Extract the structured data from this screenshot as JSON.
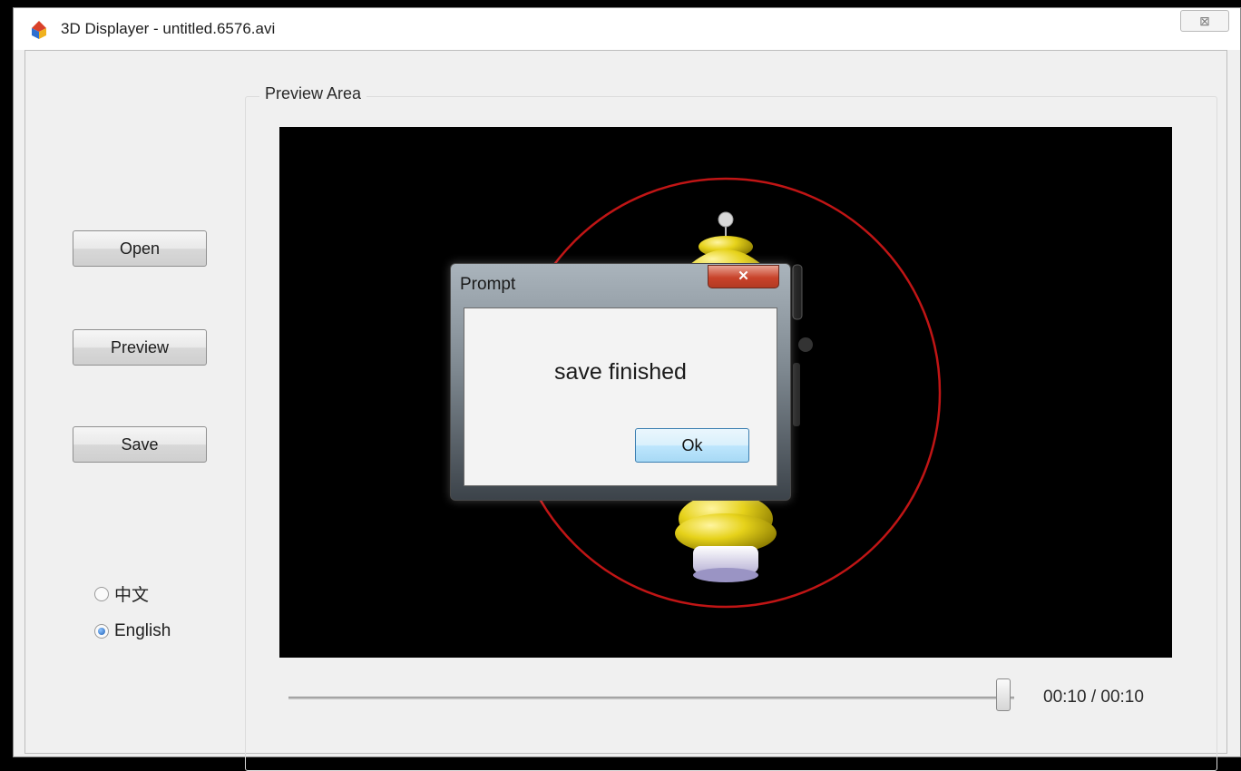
{
  "window": {
    "title": "3D Displayer - untitled.6576.avi",
    "close_symbol": "⊠",
    "app_icon": "app-logo-icon"
  },
  "sidebar": {
    "open_label": "Open",
    "preview_label": "Preview",
    "save_label": "Save"
  },
  "language": {
    "options": [
      {
        "label": "中文",
        "checked": false
      },
      {
        "label": "English",
        "checked": true
      }
    ]
  },
  "preview": {
    "group_label": "Preview Area"
  },
  "playback": {
    "time": "00:10 / 00:10",
    "progress": 1.0
  },
  "dialog": {
    "title": "Prompt",
    "close_symbol": "✕",
    "message": "save finished",
    "ok_label": "Ok"
  },
  "colors": {
    "ring": "#c01515",
    "model_yellow": "#e6d21a",
    "dialog_close_red": "#c8432b"
  }
}
